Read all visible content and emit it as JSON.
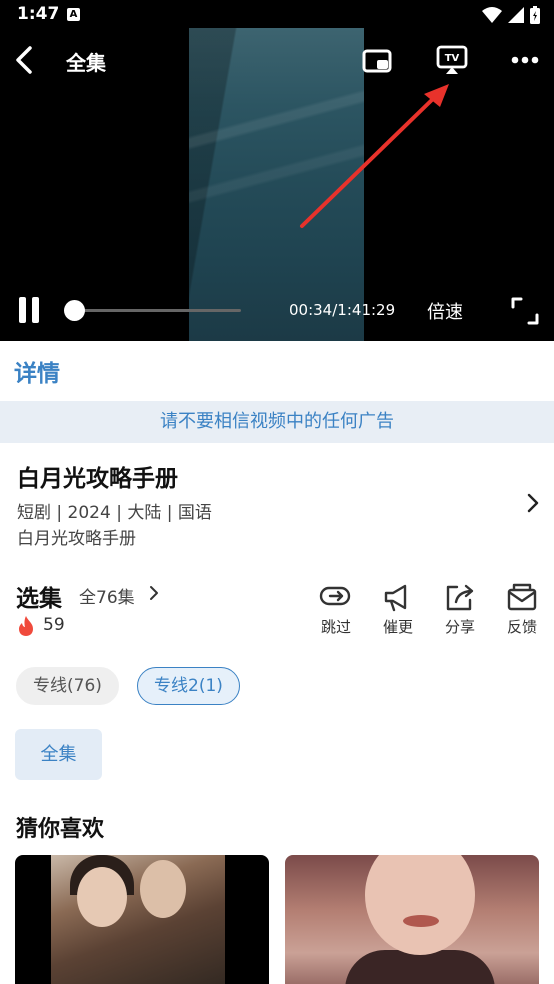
{
  "status_bar": {
    "time": "1:47",
    "notif_glyph": "A"
  },
  "player": {
    "title": "全集",
    "current_time": "00:34",
    "duration": "1:41:29",
    "time_separator": "/",
    "speed_label": "倍速",
    "progress": 0.0056
  },
  "detail_tab": "详情",
  "notice": "请不要相信视频中的任何广告",
  "show": {
    "title": "白月光攻略手册",
    "meta": "短剧 | 2024 | 大陆 | 国语",
    "subtitle": "白月光攻略手册"
  },
  "episodes": {
    "title": "选集",
    "count_label": "全76集",
    "hot_count": "59"
  },
  "actions": [
    {
      "label": "跳过",
      "icon": "skip-icon"
    },
    {
      "label": "催更",
      "icon": "megaphone-icon"
    },
    {
      "label": "分享",
      "icon": "share-icon"
    },
    {
      "label": "反馈",
      "icon": "feedback-icon"
    }
  ],
  "lines": [
    {
      "label": "专线(76)",
      "selected": false
    },
    {
      "label": "专线2(1)",
      "selected": true
    }
  ],
  "all_button": "全集",
  "recommend_title": "猜你喜欢",
  "colors": {
    "accent": "#3b82c4",
    "annotation_arrow": "#e8322b"
  }
}
